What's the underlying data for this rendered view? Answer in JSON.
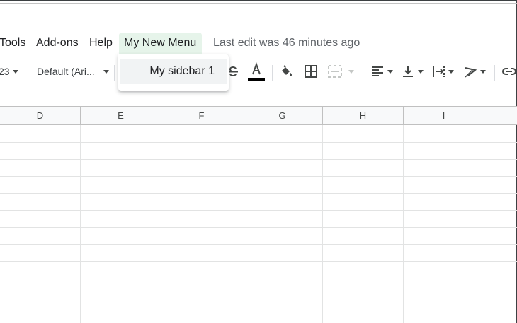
{
  "menubar": {
    "items": [
      {
        "label": "Tools"
      },
      {
        "label": "Add-ons"
      },
      {
        "label": "Help"
      },
      {
        "label": "My New Menu"
      }
    ],
    "last_edit": "Last edit was 46 minutes ago"
  },
  "toolbar": {
    "number_format": "23",
    "font_family": "Default (Ari..."
  },
  "dropdown": {
    "items": [
      {
        "label": "My sidebar 1"
      }
    ]
  },
  "grid": {
    "columns": [
      "D",
      "E",
      "F",
      "G",
      "H",
      "I",
      ""
    ]
  },
  "colors": {
    "active_menu_bg": "#e6f4ea",
    "text_color_bar": "#000000"
  }
}
